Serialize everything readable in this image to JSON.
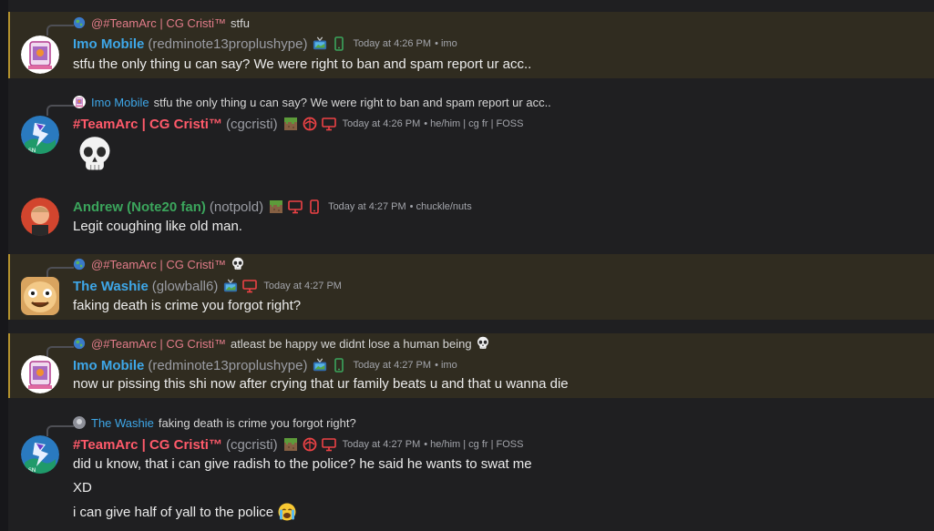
{
  "colors": {
    "background": "#1f1f21",
    "highlight": "#302c20",
    "highlight_bar": "#b3922e",
    "red_name": "#ff5a6a",
    "blue_name": "#3ea7e8",
    "green_name": "#3ba55c"
  },
  "messages": [
    {
      "reply": {
        "name": "@#TeamArc | CG Cristi™",
        "text": "stfu"
      },
      "display_name": "Imo Mobile",
      "username": "(redminote13proplushype)",
      "timestamp": "Today at 4:26 PM",
      "tag": "• imo",
      "lines": [
        "stfu the only thing u can say? We were right to ban and spam report ur acc.."
      ]
    },
    {
      "reply": {
        "name": "Imo Mobile",
        "text": "stfu the only thing u can say? We were right to ban and spam report ur acc.."
      },
      "display_name": "#TeamArc | CG Cristi™",
      "username": "(cgcristi)",
      "timestamp": "Today at 4:26 PM",
      "tag": "• he/him | cg fr | FOSS",
      "emoji": "skull-emoji"
    },
    {
      "display_name": "Andrew (Note20 fan)",
      "username": "(notpold)",
      "timestamp": "Today at 4:27 PM",
      "tag": "• chuckle/nuts",
      "lines": [
        "Legit coughing like old man."
      ]
    },
    {
      "reply": {
        "name": "@#TeamArc | CG Cristi™",
        "text": ""
      },
      "display_name": "The Washie",
      "username": "(glowball6)",
      "timestamp": "Today at 4:27 PM",
      "lines": [
        "faking death is crime you forgot right?"
      ]
    },
    {
      "reply": {
        "name": "@#TeamArc | CG Cristi™",
        "text": "atleast be happy we didnt lose a human being"
      },
      "display_name": "Imo Mobile",
      "username": "(redminote13proplushype)",
      "timestamp": "Today at 4:27 PM",
      "tag": "• imo",
      "lines": [
        "now ur pissing this shi now after crying that ur family beats u and that u wanna die"
      ]
    },
    {
      "reply": {
        "name": "The Washie",
        "text": "faking death is crime you forgot right?"
      },
      "display_name": "#TeamArc | CG Cristi™",
      "username": "(cgcristi)",
      "timestamp": "Today at 4:27 PM",
      "tag": "• he/him | cg fr | FOSS",
      "lines": [
        "did u know, that i can give radish to the police? he said he wants to swat me",
        "XD",
        "i can give half of yall to the police"
      ]
    }
  ]
}
